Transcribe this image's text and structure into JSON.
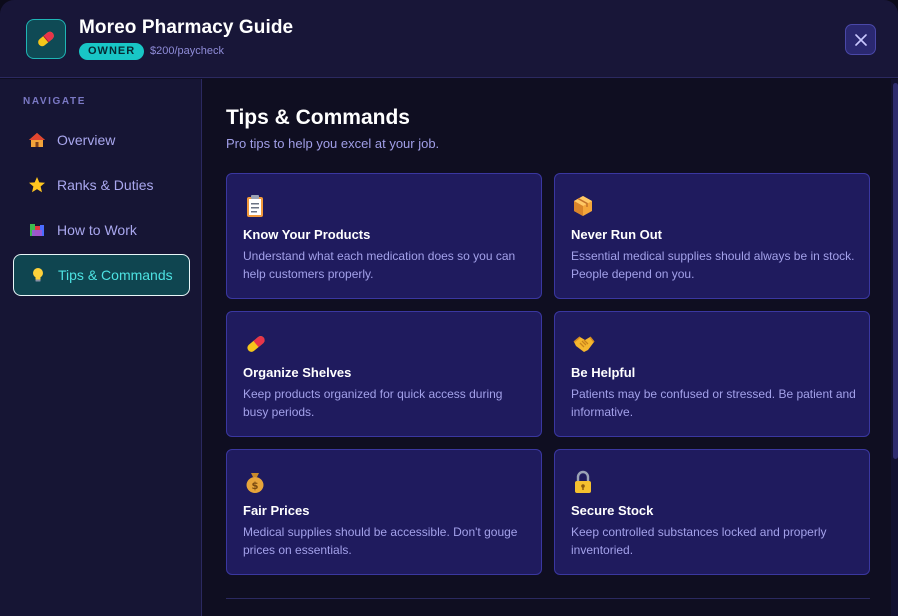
{
  "header": {
    "title": "Moreo Pharmacy Guide",
    "role_badge": "OWNER",
    "pay": "$200/paycheck",
    "app_icon": "pill-icon",
    "close_icon": "close-icon"
  },
  "sidebar": {
    "heading": "NAVIGATE",
    "items": [
      {
        "label": "Overview",
        "icon": "house-icon"
      },
      {
        "label": "Ranks & Duties",
        "icon": "star-icon"
      },
      {
        "label": "How to Work",
        "icon": "books-icon"
      },
      {
        "label": "Tips & Commands",
        "icon": "lightbulb-icon",
        "active": true
      }
    ]
  },
  "main": {
    "title": "Tips & Commands",
    "subtitle": "Pro tips to help you excel at your job.",
    "cards": [
      {
        "title": "Know Your Products",
        "text": "Understand what each medication does so you can help customers properly.",
        "icon": "clipboard-icon"
      },
      {
        "title": "Never Run Out",
        "text": "Essential medical supplies should always be in stock. People depend on you.",
        "icon": "package-icon"
      },
      {
        "title": "Organize Shelves",
        "text": "Keep products organized for quick access during busy periods.",
        "icon": "pill-icon"
      },
      {
        "title": "Be Helpful",
        "text": "Patients may be confused or stressed. Be patient and informative.",
        "icon": "handshake-icon"
      },
      {
        "title": "Fair Prices",
        "text": "Medical supplies should be accessible. Don't gouge prices on essentials.",
        "icon": "money-bag-icon"
      },
      {
        "title": "Secure Stock",
        "text": "Keep controlled substances locked and properly inventoried.",
        "icon": "lock-icon"
      }
    ]
  },
  "colors": {
    "accent": "#18c6c6",
    "card_bg": "#1f1b5e",
    "background": "#0f0e21"
  }
}
